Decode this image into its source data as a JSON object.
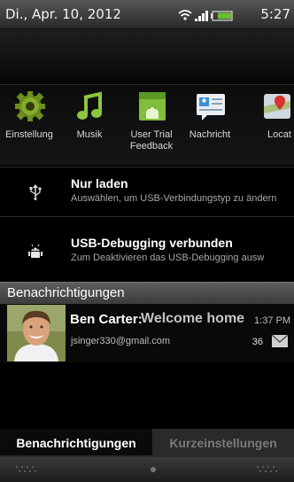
{
  "status_bar": {
    "date": "Di., Apr. 10, 2012",
    "time": "5:27",
    "icons": [
      "wifi-icon",
      "signal-icon",
      "battery-icon"
    ]
  },
  "quick_launch": [
    {
      "label": "Einstellung",
      "icon": "gear-icon"
    },
    {
      "label": "Musik",
      "icon": "music-note-icon"
    },
    {
      "label": "User Trial Feedback",
      "icon": "android-feedback-icon"
    },
    {
      "label": "Nachricht",
      "icon": "message-icon"
    },
    {
      "label": "Locat",
      "icon": "location-icon"
    }
  ],
  "usb_charge": {
    "title": "Nur laden",
    "subtitle": "Auswählen, um USB-Verbindungstyp zu ändern",
    "icon": "usb-icon"
  },
  "usb_debug": {
    "title": "USB-Debugging verbunden",
    "subtitle": "Zum Deaktivieren das USB-Debugging ausw",
    "icon": "android-debug-icon"
  },
  "notifications_header": "Benachrichtigungen",
  "notification": {
    "sender": "Ben Carter:",
    "subject": "Welcome home",
    "time": "1:37 PM",
    "account": "jsinger330@gmail.com",
    "count": "36",
    "icon": "mail-icon"
  },
  "tabs": {
    "notifications": "Benachrichtigungen",
    "quick_settings": "Kurzeinstellungen"
  },
  "colors": {
    "status_bar": "#3a3a3a",
    "section_header": "#4a4a4a",
    "background": "#000000"
  }
}
